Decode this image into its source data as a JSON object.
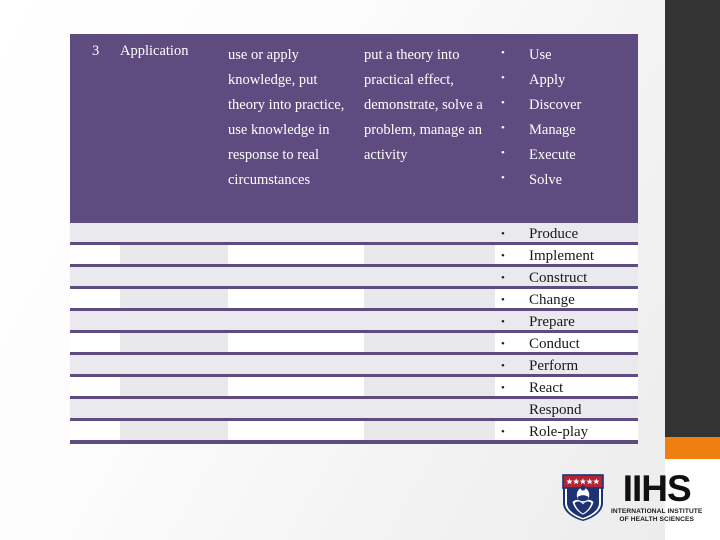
{
  "slide": {
    "accent_purple": "#5e4b7f",
    "accent_orange": "#ef7f11",
    "accent_dark": "#333333"
  },
  "table": {
    "header_row": {
      "level": "3",
      "category": "Application",
      "description": "use or apply knowledge, put theory into practice, use knowledge in response to real circumstances",
      "description2": "put a theory into practical effect, demonstrate, solve a problem, manage an activity",
      "verbs": [
        {
          "bullet": "•",
          "text": "Use"
        },
        {
          "bullet": "•",
          "text": "Apply"
        },
        {
          "bullet": "•",
          "text": "Discover"
        },
        {
          "bullet": "•",
          "text": "Manage"
        },
        {
          "bullet": "•",
          "text": "Execute"
        },
        {
          "bullet": "•",
          "text": "Solve"
        }
      ]
    },
    "body_rows": [
      {
        "style": "plain",
        "bullet": "•",
        "text": "Produce"
      },
      {
        "style": "cells",
        "bullet": "•",
        "text": "Implement"
      },
      {
        "style": "plain",
        "bullet": "•",
        "text": "Construct"
      },
      {
        "style": "cells",
        "bullet": "•",
        "text": "Change"
      },
      {
        "style": "plain",
        "bullet": "•",
        "text": "Prepare"
      },
      {
        "style": "cells",
        "bullet": "•",
        "text": "Conduct"
      },
      {
        "style": "plain",
        "bullet": "•",
        "text": "Perform"
      },
      {
        "style": "cells",
        "bullet": "•",
        "text": "React"
      },
      {
        "style": "plain",
        "bullet": "",
        "text": "Respond"
      },
      {
        "style": "cells",
        "bullet": "•",
        "text": "Role-play"
      }
    ]
  },
  "logo": {
    "acronym": "IIHS",
    "line1": "INTERNATIONAL INSTITUTE",
    "line2": "OF HEALTH SCIENCES"
  }
}
